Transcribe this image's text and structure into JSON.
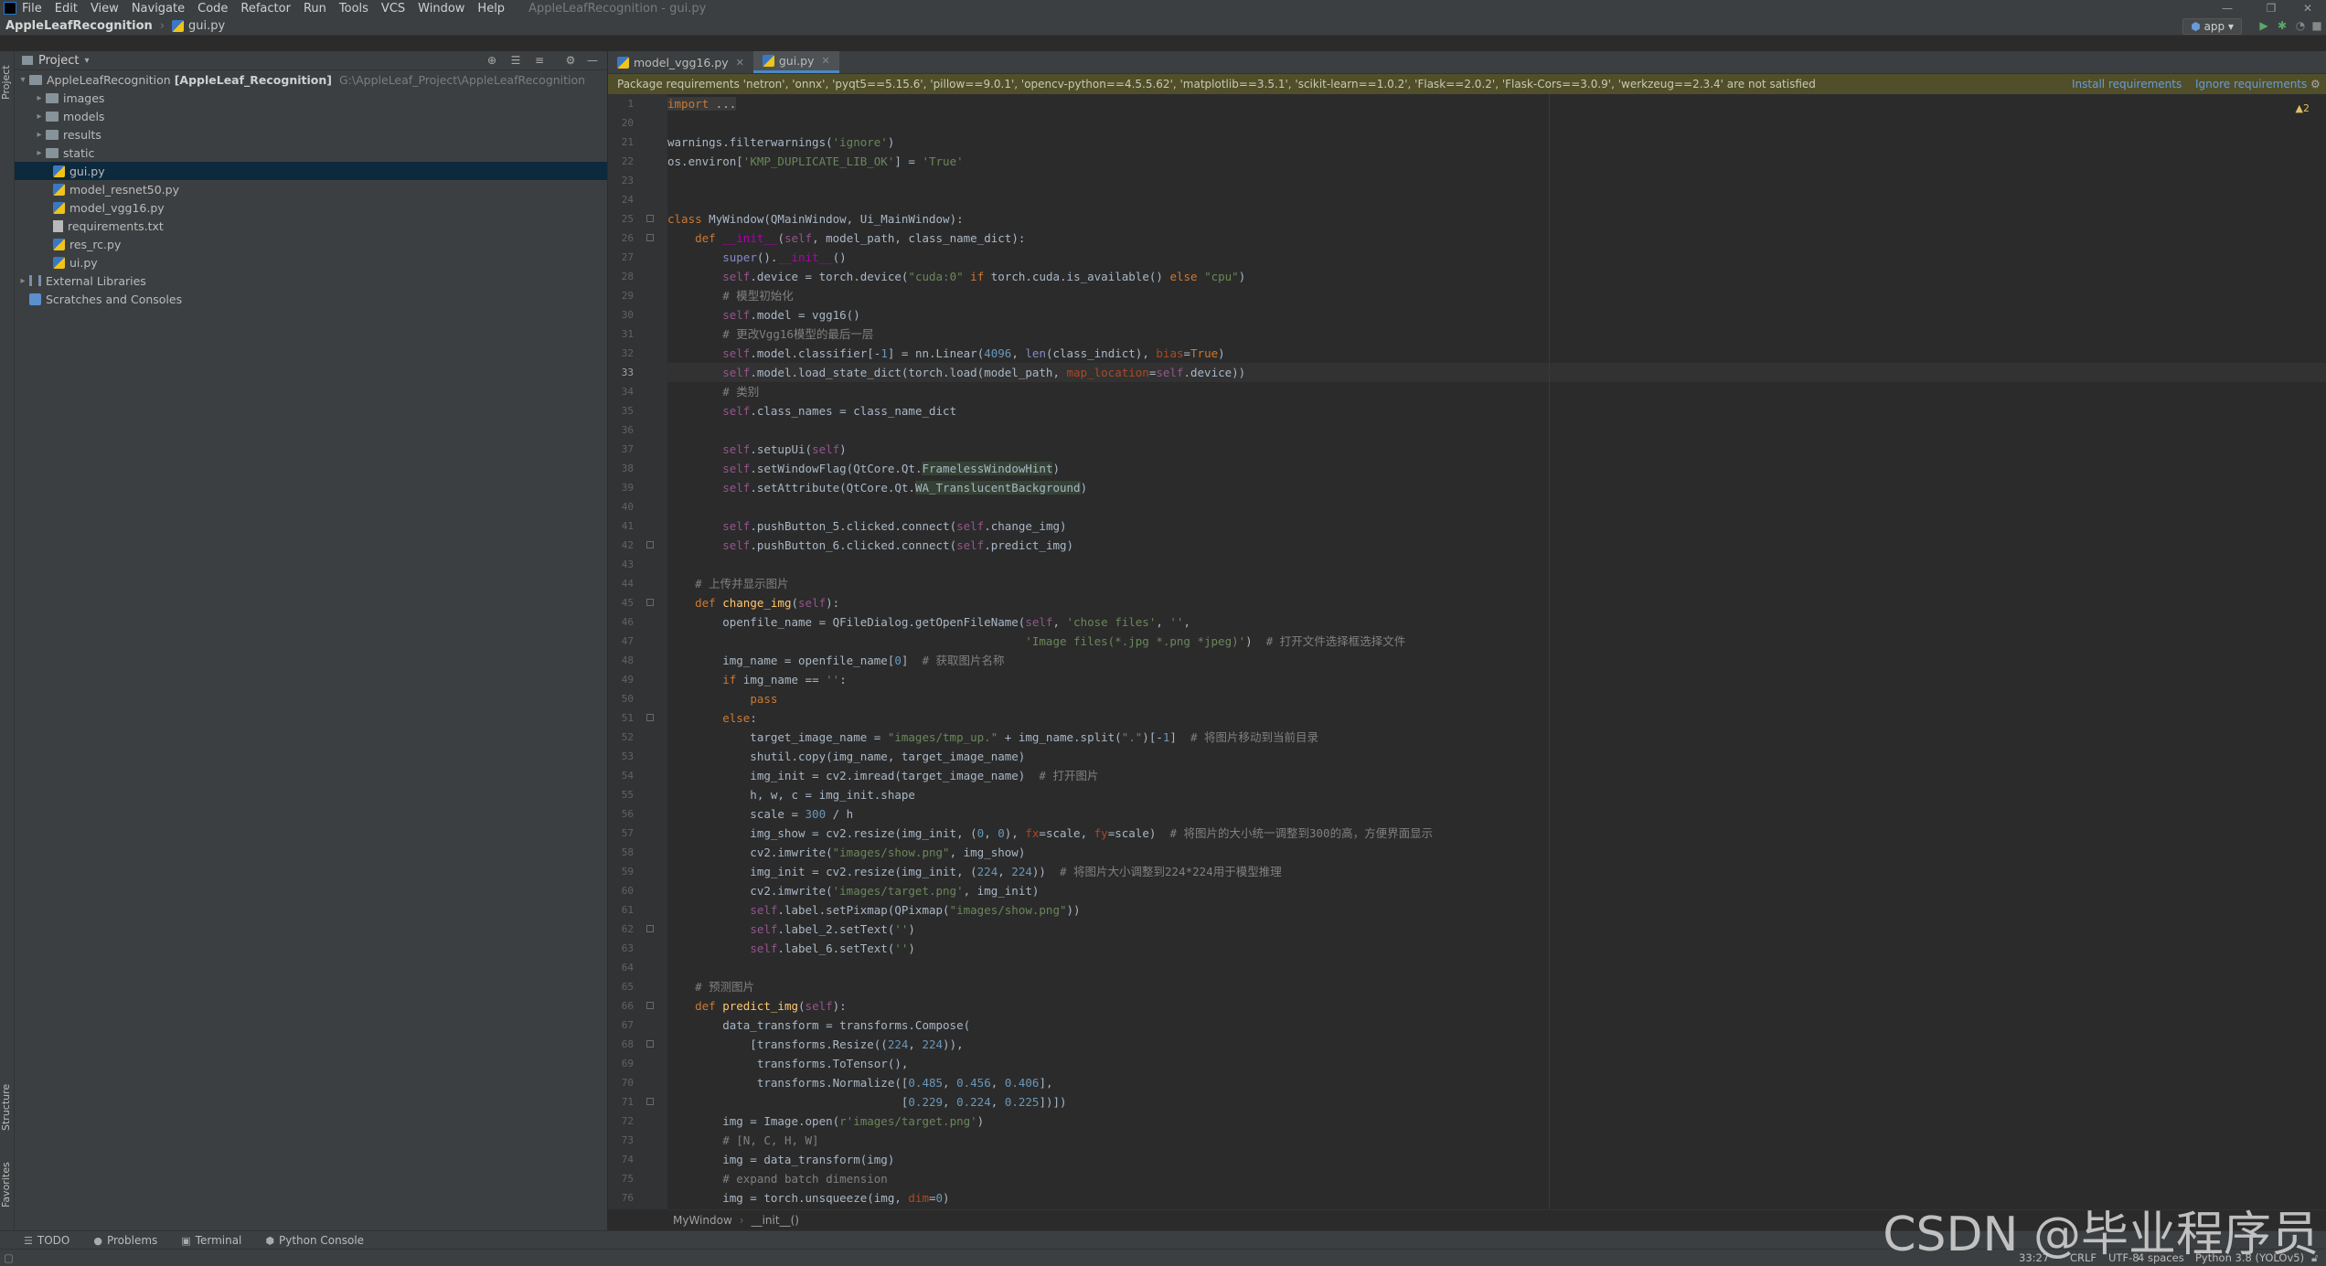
{
  "menubar": {
    "items": [
      "File",
      "Edit",
      "View",
      "Navigate",
      "Code",
      "Refactor",
      "Run",
      "Tools",
      "VCS",
      "Window",
      "Help"
    ],
    "window_title": "AppleLeafRecognition - gui.py"
  },
  "navbar": {
    "project": "AppleLeafRecognition",
    "file": "gui.py",
    "run_config": "app"
  },
  "side_tools": {
    "project": "Project",
    "structure": "Structure",
    "favorites": "Favorites"
  },
  "project_panel": {
    "title": "Project",
    "root": {
      "name": "AppleLeafRecognition",
      "module": "[AppleLeaf_Recognition]",
      "path": "G:\\AppleLeaf_Project\\AppleLeafRecognition"
    },
    "folders": [
      "images",
      "models",
      "results",
      "static"
    ],
    "files": [
      "gui.py",
      "model_resnet50.py",
      "model_vgg16.py",
      "requirements.txt",
      "res_rc.py",
      "ui.py"
    ],
    "external": "External Libraries",
    "scratches": "Scratches and Consoles"
  },
  "tabs": [
    {
      "label": "model_vgg16.py"
    },
    {
      "label": "gui.py"
    }
  ],
  "banner": {
    "message": "Package requirements 'netron', 'onnx', 'pyqt5==5.15.6', 'pillow==9.0.1', 'opencv-python==4.5.5.62', 'matplotlib==3.5.1', 'scikit-learn==1.0.2', 'Flask==2.0.2', 'Flask-Cors==3.0.9', 'werkzeug==2.3.4' are not satisfied",
    "install": "Install requirements",
    "ignore": "Ignore requirements"
  },
  "editor": {
    "line_numbers": [
      "1",
      "20",
      "21",
      "22",
      "23",
      "24",
      "25",
      "26",
      "27",
      "28",
      "29",
      "30",
      "31",
      "32",
      "33",
      "34",
      "35",
      "36",
      "37",
      "38",
      "39",
      "40",
      "41",
      "42",
      "43",
      "44",
      "45",
      "46",
      "47",
      "48",
      "49",
      "50",
      "51",
      "52",
      "53",
      "54",
      "55",
      "56",
      "57",
      "58",
      "59",
      "60",
      "61",
      "62",
      "63",
      "64",
      "65",
      "66",
      "67",
      "68",
      "69",
      "70",
      "71",
      "72",
      "73",
      "74",
      "75",
      "76"
    ],
    "warnings": "▲2"
  },
  "breadcrumb": {
    "class": "MyWindow",
    "method": "__init__()"
  },
  "bottom_tools": [
    "TODO",
    "Problems",
    "Terminal",
    "Python Console"
  ],
  "status": {
    "position": "33:27",
    "line_sep": "CRLF",
    "encoding": "UTF-8",
    "indent": "4 spaces",
    "interpreter": "Python 3.8 (YOLOv5)"
  },
  "watermark": "CSDN @毕业程序员"
}
